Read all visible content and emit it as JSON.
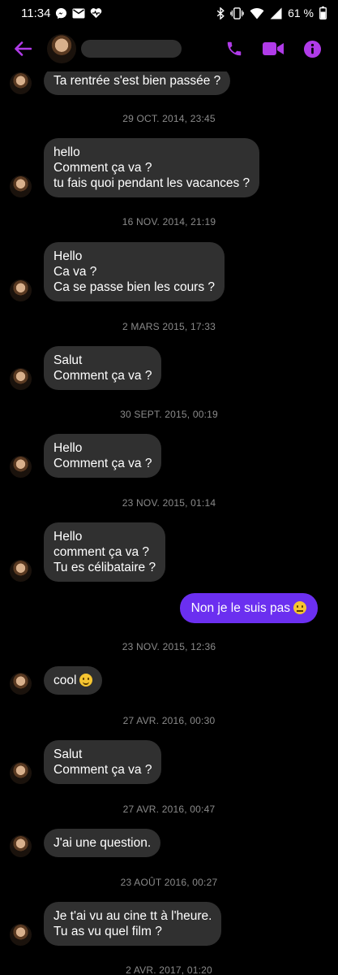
{
  "status": {
    "time": "11:34",
    "battery": "61 %"
  },
  "header": {
    "back_icon": "arrow-left-icon",
    "accent": "#b03be8"
  },
  "messages": {
    "m0": "Ta rentrée s'est bien passée ?",
    "ts1": "29 OCT. 2014, 23:45",
    "m1": "hello\nComment ça va ?\ntu fais quoi pendant les vacances ?",
    "ts2": "16 NOV. 2014, 21:19",
    "m2": "Hello\nCa va ?\nCa se passe bien les cours ?",
    "ts3": "2 MARS 2015, 17:33",
    "m3": "Salut\nComment ça va ?",
    "ts4": "30 SEPT. 2015, 00:19",
    "m4": "Hello\nComment ça va ?",
    "ts5": "23 NOV. 2015, 01:14",
    "m5": "Hello\ncomment ça va ?\nTu es célibataire ?",
    "m6_out": "Non je le suis pas",
    "ts6": "23 NOV. 2015, 12:36",
    "m7": "cool",
    "ts7": "27 AVR. 2016, 00:30",
    "m8": "Salut\nComment ça va ?",
    "ts8": "27 AVR. 2016, 00:47",
    "m9": "J'ai une question.",
    "ts9": "23 AOÛT 2016, 00:27",
    "m10": "Je t'ai vu au cine tt à l'heure.\nTu as vu quel film ?",
    "ts10": "2 AVR. 2017, 01:20"
  }
}
